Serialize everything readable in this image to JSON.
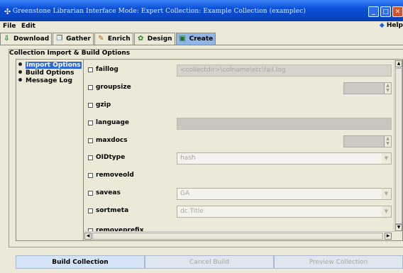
{
  "window": {
    "title": "Greenstone Librarian Interface  Mode: Expert  Collection: Example Collection (examplec)",
    "icon": "greenstone-icon",
    "controls": [
      "minimize",
      "maximize",
      "close"
    ]
  },
  "menubar": {
    "items": [
      "File",
      "Edit"
    ],
    "help_label": "Help"
  },
  "tabs": [
    {
      "label": "Download",
      "icon": "download-icon",
      "active": false
    },
    {
      "label": "Gather",
      "icon": "gather-icon",
      "active": false
    },
    {
      "label": "Enrich",
      "icon": "enrich-icon",
      "active": false
    },
    {
      "label": "Design",
      "icon": "design-icon",
      "active": false
    },
    {
      "label": "Create",
      "icon": "create-icon",
      "active": true
    }
  ],
  "panel": {
    "title": "Collection Import & Build Options",
    "left_list": [
      "Import Options",
      "Build Options",
      "Message Log"
    ],
    "selected_index": 0
  },
  "options": [
    {
      "label": "faillog",
      "checked": false,
      "control": "text",
      "value": "<collectdir>\\colname\\etc\\fail.log"
    },
    {
      "label": "groupsize",
      "checked": false,
      "control": "spinner",
      "value": ""
    },
    {
      "label": "gzip",
      "checked": false,
      "control": "none"
    },
    {
      "label": "language",
      "checked": false,
      "control": "text",
      "value": ""
    },
    {
      "label": "maxdocs",
      "checked": false,
      "control": "spinner",
      "value": ""
    },
    {
      "label": "OIDtype",
      "checked": false,
      "control": "combo",
      "value": "hash"
    },
    {
      "label": "removeold",
      "checked": false,
      "control": "none"
    },
    {
      "label": "saveas",
      "checked": false,
      "control": "combo",
      "value": "GA"
    },
    {
      "label": "sortmeta",
      "checked": false,
      "control": "combo",
      "value": "dc.Title"
    },
    {
      "label": "removeprefix",
      "checked": false,
      "control": "none"
    }
  ],
  "buttons": {
    "build": "Build Collection",
    "cancel": "Cancel Build",
    "preview": "Preview Collection"
  }
}
